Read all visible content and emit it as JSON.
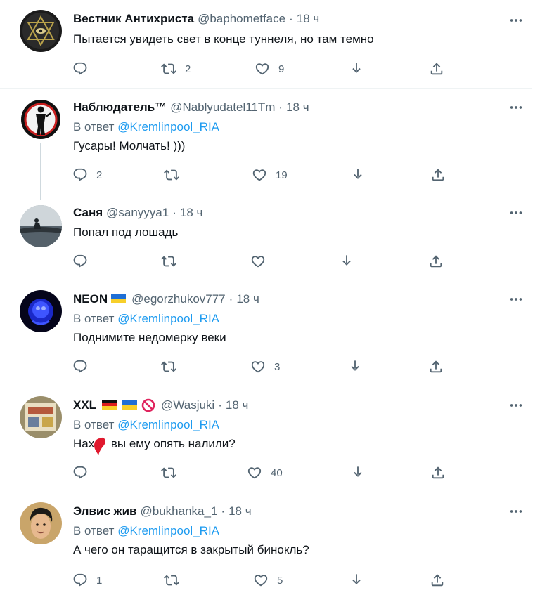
{
  "tweets": [
    {
      "name": "Вестник Антихриста",
      "handle": "@baphometface",
      "time": "18 ч",
      "reply_label": "",
      "reply_to": "",
      "text": "Пытается увидеть свет в конце туннеля, но там темно",
      "replies": "",
      "retweets": "2",
      "likes": "9"
    },
    {
      "name": "Наблюдатель™",
      "handle": "@Nablyudatel11Tm",
      "time": "18 ч",
      "reply_label": "В ответ",
      "reply_to": "@Kremlinpool_RIA",
      "text": "Гусары! Молчать! )))",
      "replies": "2",
      "retweets": "",
      "likes": "19"
    },
    {
      "name": "Саня",
      "handle": "@sanyyya1",
      "time": "18 ч",
      "reply_label": "",
      "reply_to": "",
      "text": "Попал под лошадь",
      "replies": "",
      "retweets": "",
      "likes": ""
    },
    {
      "name": "NEON",
      "handle": "@egorzhukov777",
      "time": "18 ч",
      "reply_label": "В ответ",
      "reply_to": "@Kremlinpool_RIA",
      "text": "Поднимите недомерку веки",
      "replies": "",
      "retweets": "",
      "likes": "3"
    },
    {
      "name": "XXL",
      "handle": "@Wasjuki",
      "time": "18 ч",
      "reply_label": "В ответ",
      "reply_to": "@Kremlinpool_RIA",
      "text": "Нах     вы ему опять налили?",
      "replies": "",
      "retweets": "",
      "likes": "40"
    },
    {
      "name": "Элвис жив",
      "handle": "@bukhanka_1",
      "time": "18 ч",
      "reply_label": "В ответ",
      "reply_to": "@Kremlinpool_RIA",
      "text": "А чего он таращится в закрытый бинокль?",
      "replies": "1",
      "retweets": "",
      "likes": "5"
    }
  ],
  "separator": "·",
  "icons": {
    "reply": "reply-icon",
    "retweet": "retweet-icon",
    "like": "heart-icon",
    "share_dm": "share-arrow-down-icon",
    "share": "share-upload-icon",
    "more": "more-dots-icon"
  },
  "colors": {
    "text": "#0f1419",
    "secondary": "#536471",
    "link": "#1d9bf0",
    "border": "#eff3f4"
  }
}
